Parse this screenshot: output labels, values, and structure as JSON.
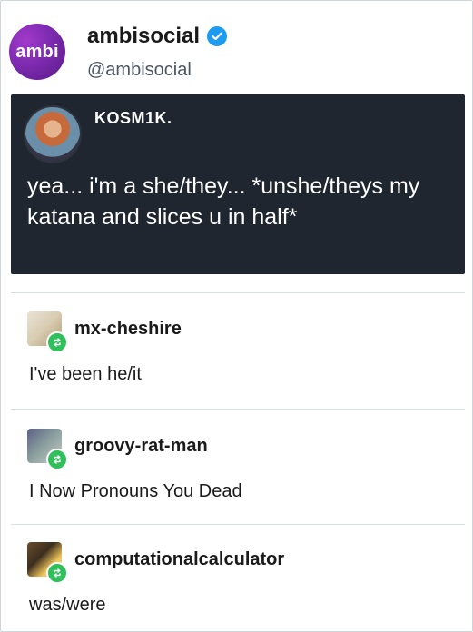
{
  "post": {
    "author": {
      "avatar_text": "ambi",
      "display_name": "ambisocial",
      "handle": "@ambisocial",
      "verified": true,
      "brand_color": "#7d2ab0"
    },
    "quoted": {
      "author": "KOSM1K.",
      "text": "yea... i'm a she/they... *unshe/theys my katana and slices u in half*",
      "background": "#1f2630"
    },
    "reblogs": [
      {
        "username": "mx-cheshire",
        "text": "I've been he/it"
      },
      {
        "username": "groovy-rat-man",
        "text": "I Now Pronouns You Dead"
      },
      {
        "username": "computationalcalculator",
        "text": "was/were"
      }
    ]
  },
  "colors": {
    "verified": "#1d9bf0",
    "reblog_badge": "#2fbf5b"
  },
  "icons": [
    "verified-check-icon",
    "reblog-icon"
  ]
}
